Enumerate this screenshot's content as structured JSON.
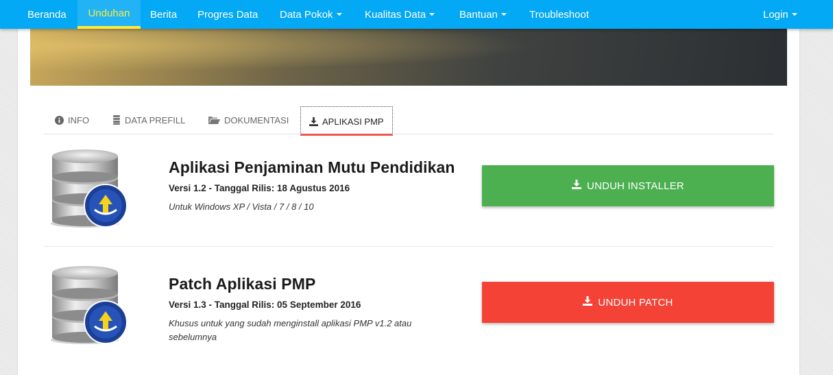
{
  "nav": {
    "items": [
      {
        "label": "Beranda",
        "active": false,
        "dropdown": false
      },
      {
        "label": "Unduhan",
        "active": true,
        "dropdown": false
      },
      {
        "label": "Berita",
        "active": false,
        "dropdown": false
      },
      {
        "label": "Progres Data",
        "active": false,
        "dropdown": false
      },
      {
        "label": "Data Pokok",
        "active": false,
        "dropdown": true
      },
      {
        "label": "Kualitas Data",
        "active": false,
        "dropdown": true
      },
      {
        "label": "Bantuan",
        "active": false,
        "dropdown": true
      },
      {
        "label": "Troubleshoot",
        "active": false,
        "dropdown": false
      }
    ],
    "login_label": "Login"
  },
  "tabs": [
    {
      "label": "INFO",
      "icon": "info-circle-icon",
      "active": false
    },
    {
      "label": "DATA PREFILL",
      "icon": "database-icon",
      "active": false
    },
    {
      "label": "DOKUMENTASI",
      "icon": "folder-open-icon",
      "active": false
    },
    {
      "label": "APLIKASI PMP",
      "icon": "download-icon",
      "active": true
    }
  ],
  "apps": [
    {
      "title": "Aplikasi Penjaminan Mutu Pendidikan",
      "version": "Versi 1.2 - Tanggal Rilis: 18 Agustus 2016",
      "note": "Untuk Windows XP / Vista / 7 / 8 / 10",
      "button_label": "UNDUH INSTALLER",
      "button_color": "#4caf50",
      "icon": "database-server-icon"
    },
    {
      "title": "Patch Aplikasi PMP",
      "version": "Versi 1.3 - Tanggal Rilis: 05 September 2016",
      "note": "Khusus untuk yang sudah menginstall aplikasi PMP v1.2 atau sebelumnya",
      "button_label": "UNDUH PATCH",
      "button_color": "#f44336",
      "icon": "database-server-icon"
    }
  ],
  "colors": {
    "navbar": "#03a9f4",
    "nav_active": "#ffeb3b",
    "tab_active_underline": "#ef5350"
  }
}
